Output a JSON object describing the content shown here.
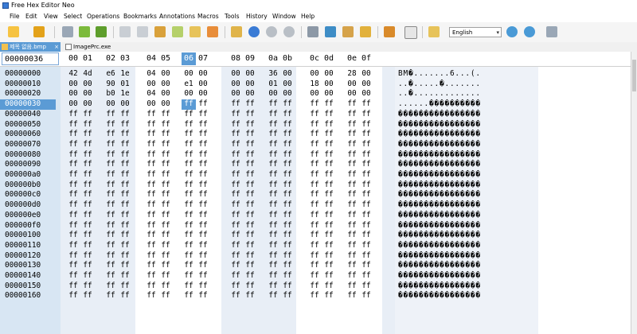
{
  "window": {
    "title": "Free Hex Editor Neo"
  },
  "menu": [
    "File",
    "Edit",
    "View",
    "Select",
    "Operations",
    "Bookmarks",
    "Annotations",
    "Macros",
    "Tools",
    "History",
    "Window",
    "Help"
  ],
  "toolbar": {
    "language": "English"
  },
  "tabs": [
    {
      "label": "제목 없음.bmp",
      "close": "×",
      "active": true
    },
    {
      "label": "ImagePrc.exe",
      "active": false
    }
  ],
  "header": {
    "current_offset": "00000036",
    "columns": [
      "00",
      "01",
      "02",
      "03",
      "04",
      "05",
      "06",
      "07",
      "08",
      "09",
      "0a",
      "0b",
      "0c",
      "0d",
      "0e",
      "0f"
    ],
    "selected_column": 6
  },
  "rows": [
    {
      "offset": "00000000",
      "bytes": [
        "42",
        "4d",
        "e6",
        "1e",
        "04",
        "00",
        "00",
        "00",
        "00",
        "00",
        "36",
        "00",
        "00",
        "00",
        "28",
        "00"
      ],
      "ascii": "BM�.......6...(."
    },
    {
      "offset": "00000010",
      "bytes": [
        "00",
        "00",
        "90",
        "01",
        "00",
        "00",
        "e1",
        "00",
        "00",
        "00",
        "01",
        "00",
        "18",
        "00",
        "00",
        "00"
      ],
      "ascii": "..�.....�......."
    },
    {
      "offset": "00000020",
      "bytes": [
        "00",
        "00",
        "b0",
        "1e",
        "04",
        "00",
        "00",
        "00",
        "00",
        "00",
        "00",
        "00",
        "00",
        "00",
        "00",
        "00"
      ],
      "ascii": "..�............."
    },
    {
      "offset": "00000030",
      "bytes": [
        "00",
        "00",
        "00",
        "00",
        "00",
        "00",
        "ff",
        "ff",
        "ff",
        "ff",
        "ff",
        "ff",
        "ff",
        "ff",
        "ff",
        "ff"
      ],
      "ascii": "......����������"
    },
    {
      "offset": "00000040",
      "bytes": [
        "ff",
        "ff",
        "ff",
        "ff",
        "ff",
        "ff",
        "ff",
        "ff",
        "ff",
        "ff",
        "ff",
        "ff",
        "ff",
        "ff",
        "ff",
        "ff"
      ],
      "ascii": "����������������"
    },
    {
      "offset": "00000050",
      "bytes": [
        "ff",
        "ff",
        "ff",
        "ff",
        "ff",
        "ff",
        "ff",
        "ff",
        "ff",
        "ff",
        "ff",
        "ff",
        "ff",
        "ff",
        "ff",
        "ff"
      ],
      "ascii": "����������������"
    },
    {
      "offset": "00000060",
      "bytes": [
        "ff",
        "ff",
        "ff",
        "ff",
        "ff",
        "ff",
        "ff",
        "ff",
        "ff",
        "ff",
        "ff",
        "ff",
        "ff",
        "ff",
        "ff",
        "ff"
      ],
      "ascii": "����������������"
    },
    {
      "offset": "00000070",
      "bytes": [
        "ff",
        "ff",
        "ff",
        "ff",
        "ff",
        "ff",
        "ff",
        "ff",
        "ff",
        "ff",
        "ff",
        "ff",
        "ff",
        "ff",
        "ff",
        "ff"
      ],
      "ascii": "����������������"
    },
    {
      "offset": "00000080",
      "bytes": [
        "ff",
        "ff",
        "ff",
        "ff",
        "ff",
        "ff",
        "ff",
        "ff",
        "ff",
        "ff",
        "ff",
        "ff",
        "ff",
        "ff",
        "ff",
        "ff"
      ],
      "ascii": "����������������"
    },
    {
      "offset": "00000090",
      "bytes": [
        "ff",
        "ff",
        "ff",
        "ff",
        "ff",
        "ff",
        "ff",
        "ff",
        "ff",
        "ff",
        "ff",
        "ff",
        "ff",
        "ff",
        "ff",
        "ff"
      ],
      "ascii": "����������������"
    },
    {
      "offset": "000000a0",
      "bytes": [
        "ff",
        "ff",
        "ff",
        "ff",
        "ff",
        "ff",
        "ff",
        "ff",
        "ff",
        "ff",
        "ff",
        "ff",
        "ff",
        "ff",
        "ff",
        "ff"
      ],
      "ascii": "����������������"
    },
    {
      "offset": "000000b0",
      "bytes": [
        "ff",
        "ff",
        "ff",
        "ff",
        "ff",
        "ff",
        "ff",
        "ff",
        "ff",
        "ff",
        "ff",
        "ff",
        "ff",
        "ff",
        "ff",
        "ff"
      ],
      "ascii": "����������������"
    },
    {
      "offset": "000000c0",
      "bytes": [
        "ff",
        "ff",
        "ff",
        "ff",
        "ff",
        "ff",
        "ff",
        "ff",
        "ff",
        "ff",
        "ff",
        "ff",
        "ff",
        "ff",
        "ff",
        "ff"
      ],
      "ascii": "����������������"
    },
    {
      "offset": "000000d0",
      "bytes": [
        "ff",
        "ff",
        "ff",
        "ff",
        "ff",
        "ff",
        "ff",
        "ff",
        "ff",
        "ff",
        "ff",
        "ff",
        "ff",
        "ff",
        "ff",
        "ff"
      ],
      "ascii": "����������������"
    },
    {
      "offset": "000000e0",
      "bytes": [
        "ff",
        "ff",
        "ff",
        "ff",
        "ff",
        "ff",
        "ff",
        "ff",
        "ff",
        "ff",
        "ff",
        "ff",
        "ff",
        "ff",
        "ff",
        "ff"
      ],
      "ascii": "����������������"
    },
    {
      "offset": "000000f0",
      "bytes": [
        "ff",
        "ff",
        "ff",
        "ff",
        "ff",
        "ff",
        "ff",
        "ff",
        "ff",
        "ff",
        "ff",
        "ff",
        "ff",
        "ff",
        "ff",
        "ff"
      ],
      "ascii": "����������������"
    },
    {
      "offset": "00000100",
      "bytes": [
        "ff",
        "ff",
        "ff",
        "ff",
        "ff",
        "ff",
        "ff",
        "ff",
        "ff",
        "ff",
        "ff",
        "ff",
        "ff",
        "ff",
        "ff",
        "ff"
      ],
      "ascii": "����������������"
    },
    {
      "offset": "00000110",
      "bytes": [
        "ff",
        "ff",
        "ff",
        "ff",
        "ff",
        "ff",
        "ff",
        "ff",
        "ff",
        "ff",
        "ff",
        "ff",
        "ff",
        "ff",
        "ff",
        "ff"
      ],
      "ascii": "����������������"
    },
    {
      "offset": "00000120",
      "bytes": [
        "ff",
        "ff",
        "ff",
        "ff",
        "ff",
        "ff",
        "ff",
        "ff",
        "ff",
        "ff",
        "ff",
        "ff",
        "ff",
        "ff",
        "ff",
        "ff"
      ],
      "ascii": "����������������"
    },
    {
      "offset": "00000130",
      "bytes": [
        "ff",
        "ff",
        "ff",
        "ff",
        "ff",
        "ff",
        "ff",
        "ff",
        "ff",
        "ff",
        "ff",
        "ff",
        "ff",
        "ff",
        "ff",
        "ff"
      ],
      "ascii": "����������������"
    },
    {
      "offset": "00000140",
      "bytes": [
        "ff",
        "ff",
        "ff",
        "ff",
        "ff",
        "ff",
        "ff",
        "ff",
        "ff",
        "ff",
        "ff",
        "ff",
        "ff",
        "ff",
        "ff",
        "ff"
      ],
      "ascii": "����������������"
    },
    {
      "offset": "00000150",
      "bytes": [
        "ff",
        "ff",
        "ff",
        "ff",
        "ff",
        "ff",
        "ff",
        "ff",
        "ff",
        "ff",
        "ff",
        "ff",
        "ff",
        "ff",
        "ff",
        "ff"
      ],
      "ascii": "����������������"
    },
    {
      "offset": "00000160",
      "bytes": [
        "ff",
        "ff",
        "ff",
        "ff",
        "ff",
        "ff",
        "ff",
        "ff",
        "ff",
        "ff",
        "ff",
        "ff",
        "ff",
        "ff",
        "ff",
        "ff"
      ],
      "ascii": "����������������"
    }
  ],
  "selection": {
    "row_offset": "00000030",
    "byte_column": 6
  },
  "colors": {
    "selection": "#5b9bd5",
    "offset_column_bg": "#d8e6f3",
    "column_band": "#e8eef6"
  },
  "toolbar_icons": [
    "new-file-icon",
    "open-file-icon",
    "save-icon",
    "save-all-icon",
    "save-as-icon",
    "undo-icon",
    "redo-icon",
    "cut-icon",
    "copy-icon",
    "paste-icon",
    "fill-icon",
    "open-folder-icon",
    "find-icon",
    "zoom-in-icon",
    "zoom-out-icon",
    "bookmark-add-icon",
    "highlight-icon",
    "delete-icon",
    "book-icon",
    "structure-icon",
    "hex-view-icon",
    "columns-icon",
    "globe-icon",
    "globe-settings-icon",
    "tools-icon"
  ]
}
